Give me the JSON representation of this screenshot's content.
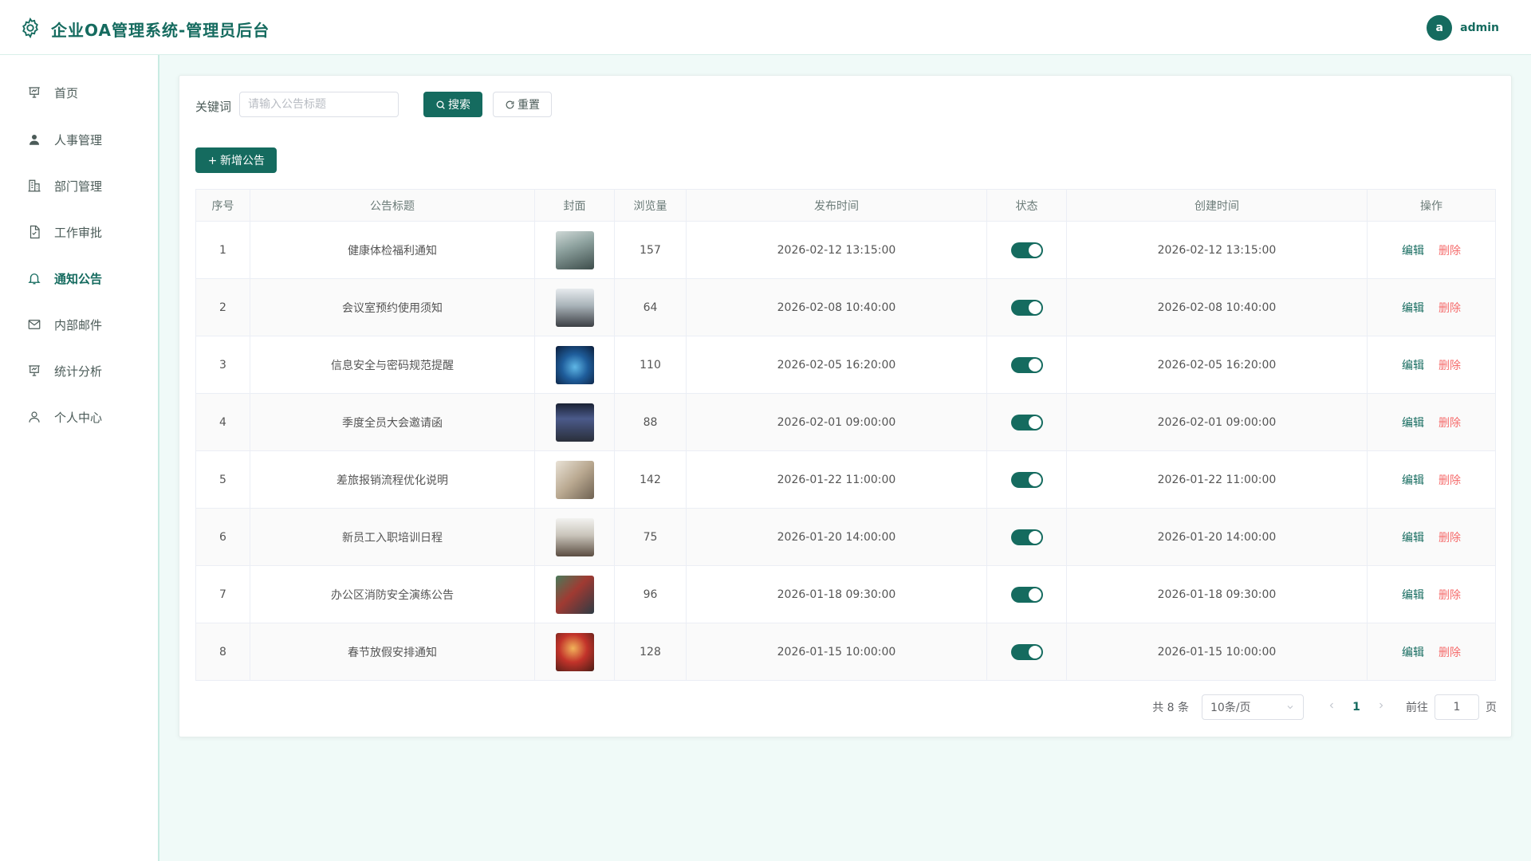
{
  "header": {
    "title": "企业OA管理系统-管理员后台",
    "avatar_letter": "a",
    "username": "admin"
  },
  "sidebar": {
    "items": [
      {
        "label": "首页",
        "icon": "presentation-icon"
      },
      {
        "label": "人事管理",
        "icon": "user-icon"
      },
      {
        "label": "部门管理",
        "icon": "building-icon"
      },
      {
        "label": "工作审批",
        "icon": "document-check-icon"
      },
      {
        "label": "通知公告",
        "icon": "bell-icon",
        "active": true
      },
      {
        "label": "内部邮件",
        "icon": "mail-icon"
      },
      {
        "label": "统计分析",
        "icon": "presentation-chart-icon"
      },
      {
        "label": "个人中心",
        "icon": "user-outline-icon"
      }
    ]
  },
  "search": {
    "label": "关键词",
    "placeholder": "请输入公告标题",
    "value": "",
    "search_label": "搜索",
    "reset_label": "重置"
  },
  "toolbar": {
    "add_label": "新增公告"
  },
  "table": {
    "columns": [
      "序号",
      "公告标题",
      "封面",
      "浏览量",
      "发布时间",
      "状态",
      "创建时间",
      "操作"
    ],
    "rows": [
      {
        "index": "1",
        "title": "健康体检福利通知",
        "views": "157",
        "publish_time": "2026-02-12 13:15:00",
        "status": true,
        "create_time": "2026-02-12 13:15:00"
      },
      {
        "index": "2",
        "title": "会议室预约使用须知",
        "views": "64",
        "publish_time": "2026-02-08 10:40:00",
        "status": true,
        "create_time": "2026-02-08 10:40:00"
      },
      {
        "index": "3",
        "title": "信息安全与密码规范提醒",
        "views": "110",
        "publish_time": "2026-02-05 16:20:00",
        "status": true,
        "create_time": "2026-02-05 16:20:00"
      },
      {
        "index": "4",
        "title": "季度全员大会邀请函",
        "views": "88",
        "publish_time": "2026-02-01 09:00:00",
        "status": true,
        "create_time": "2026-02-01 09:00:00"
      },
      {
        "index": "5",
        "title": "差旅报销流程优化说明",
        "views": "142",
        "publish_time": "2026-01-22 11:00:00",
        "status": true,
        "create_time": "2026-01-22 11:00:00"
      },
      {
        "index": "6",
        "title": "新员工入职培训日程",
        "views": "75",
        "publish_time": "2026-01-20 14:00:00",
        "status": true,
        "create_time": "2026-01-20 14:00:00"
      },
      {
        "index": "7",
        "title": "办公区消防安全演练公告",
        "views": "96",
        "publish_time": "2026-01-18 09:30:00",
        "status": true,
        "create_time": "2026-01-18 09:30:00"
      },
      {
        "index": "8",
        "title": "春节放假安排通知",
        "views": "128",
        "publish_time": "2026-01-15 10:00:00",
        "status": true,
        "create_time": "2026-01-15 10:00:00"
      }
    ],
    "edit_label": "编辑",
    "delete_label": "删除"
  },
  "pagination": {
    "total_text": "共 8 条",
    "page_size": "10条/页",
    "current_page": "1",
    "goto_label": "前往",
    "goto_value": "1",
    "page_suffix": "页"
  },
  "colors": {
    "primary": "#156b5f",
    "danger": "#f56c6c"
  }
}
